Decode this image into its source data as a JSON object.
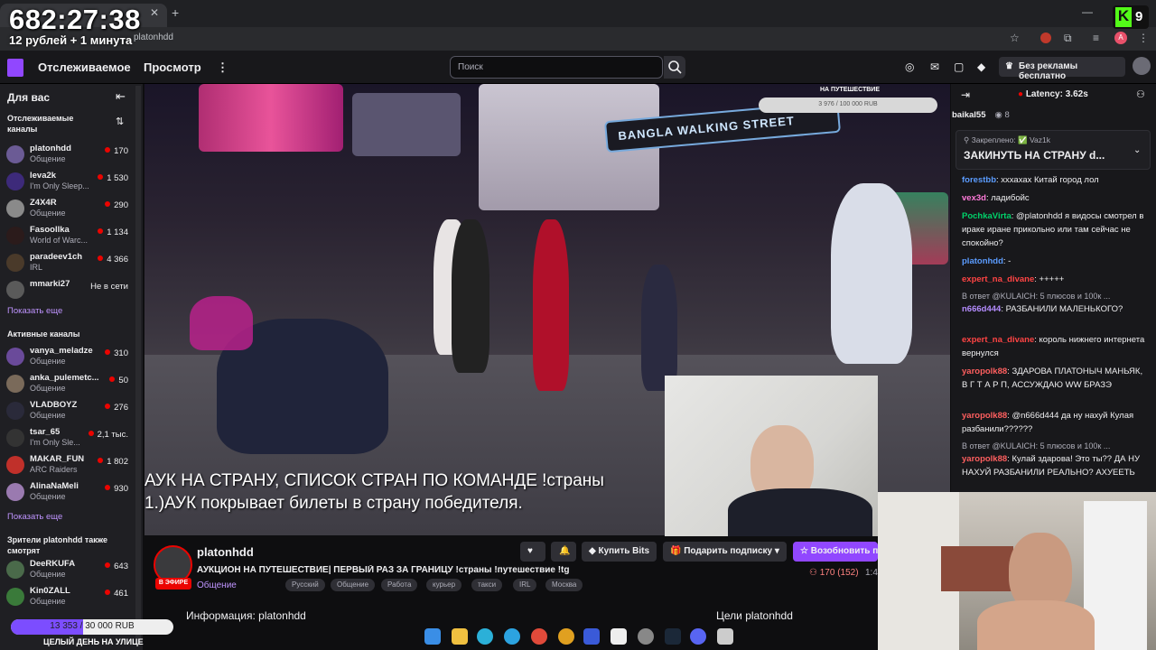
{
  "overlay": {
    "timer": "682:27:38",
    "timer_sub": "12 рублей + 1 минута",
    "k_badge": "K",
    "k_badge_num": "9",
    "goal_title": "НА ПУТЕШЕСТВИЕ",
    "goal_progress": "3 976 / 100 000 RUB",
    "goal_fraction": 0.04,
    "bottom_progress": "13 353 / 30 000 RUB",
    "bottom_fraction": 0.445,
    "bottom_label": "ЦЕЛЫЙ ДЕНЬ НА УЛИЦЕ",
    "subtitle_line1": "АУК НА СТРАНУ, СПИСОК СТРАН ПО КОМАНДЕ !страны",
    "subtitle_line2": "1.)АУК покрывает билеты в страну победителя."
  },
  "browser": {
    "url": "platonhdd",
    "avatar_letter": "A"
  },
  "nav": {
    "following": "Отслеживаемое",
    "browse": "Просмотр",
    "search_placeholder": "Поиск",
    "no_ads": "Без рекламы бесплатно"
  },
  "sidebar": {
    "for_you": "Для вас",
    "followed_title": "Отслеживаемые каналы",
    "followed": [
      {
        "name": "platonhdd",
        "game": "Общение",
        "viewers": "170",
        "color": "#6b5b95"
      },
      {
        "name": "leva2k",
        "game": "I'm Only Sleep...",
        "viewers": "1 530",
        "color": "#3d2a7a"
      },
      {
        "name": "Z4X4R",
        "game": "Общение",
        "viewers": "290",
        "color": "#8a8a8a"
      },
      {
        "name": "Fasoollka",
        "game": "World of Warc...",
        "viewers": "1 134",
        "color": "#2b1b1b"
      },
      {
        "name": "paradeev1ch",
        "game": "IRL",
        "viewers": "4 366",
        "color": "#4a3a2a"
      },
      {
        "name": "mmarki27",
        "game": "",
        "viewers": "Не в сети",
        "color": "#5a5a5a"
      }
    ],
    "show_more": "Показать еще",
    "active_title": "Активные каналы",
    "active": [
      {
        "name": "vanya_meladze",
        "game": "Общение",
        "viewers": "310",
        "color": "#6a4a9a"
      },
      {
        "name": "anka_pulemetc...",
        "game": "Общение",
        "viewers": "50",
        "color": "#7a6a5a"
      },
      {
        "name": "VLADBOYZ",
        "game": "Общение",
        "viewers": "276",
        "color": "#2a2a3a"
      },
      {
        "name": "tsar_65",
        "game": "I'm Only Sle...",
        "viewers": "2,1 тыс.",
        "color": "#333"
      },
      {
        "name": "MAKAR_FUN",
        "game": "ARC Raiders",
        "viewers": "1 802",
        "color": "#c0302a"
      },
      {
        "name": "AlinaNaMeli",
        "game": "Общение",
        "viewers": "930",
        "color": "#9a7ab0"
      }
    ],
    "show_more2": "Показать еще",
    "also_watch_title": "Зрители platonhdd также смотрят",
    "also": [
      {
        "name": "DeeRKUFA",
        "game": "Общение",
        "viewers": "643",
        "color": "#4a6a4a"
      },
      {
        "name": "Kin0ZALL",
        "game": "Общение",
        "viewers": "461",
        "color": "#3a7a3a"
      }
    ]
  },
  "stream": {
    "name": "platonhdd",
    "title": "АУКЦИОН НА ПУТЕШЕСТВИЕ| ПЕРВЫЙ РАЗ ЗА ГРАНИЦУ !страны !путешествие !tg",
    "live": "В ЭФИРЕ",
    "category": "Общение",
    "tags": [
      "Русский",
      "Общение",
      "Работа",
      "курьер",
      "такси",
      "IRL",
      "Москва"
    ],
    "viewers": "170 (152)",
    "uptime": "1:4",
    "buy_bits": "Купить Bits",
    "gift_sub": "Подарить подписку",
    "resub": "Возобновить по",
    "about": "Информация: platonhdd",
    "goals": "Цели platonhdd"
  },
  "chat": {
    "latency": "Latency: 3.62s",
    "top_user": "baikal55",
    "top_count": "8",
    "pinned_by": "Закреплено: ✅ Vaz1k",
    "pinned_text": "ЗАКИНУТЬ НА СТРАНУ d...",
    "messages": [
      {
        "user": "forestbb",
        "color": "#5b9cff",
        "text": ": хххахах Китай город лол"
      },
      {
        "user": "vex3d",
        "color": "#ff7ad9",
        "text": ": ладибойс"
      },
      {
        "user": "PochkaVirta",
        "color": "#00d26a",
        "text": ": @platonhdd я видосы смотрел в ираке иране прикольно или там сейчас не спокойно?"
      },
      {
        "user": "platonhdd",
        "color": "#5b9cff",
        "text": ": -"
      },
      {
        "user": "expert_na_divane",
        "color": "#ff4444",
        "text": ": +++++"
      },
      {
        "reply": "В ответ @KULAICH: 5 плюсов и 100к ..."
      },
      {
        "user": "n666d444",
        "color": "#b48cff",
        "text": ": РАЗБАНИЛИ МАЛЕНЬКОГО?"
      },
      {
        "user": "expert_na_divane",
        "color": "#ff4444",
        "text": ": король нижнего интернета вернулся"
      },
      {
        "user": "yaropolk88",
        "color": "#ff5f5f",
        "text": ": ЗДАРОВА ПЛАТОНЫЧ МАНЬЯК, В Г Т А Р П, АССУЖДАЮ WW БРАЗЭ"
      },
      {
        "user": "yaropolk88",
        "color": "#ff5f5f",
        "text": ": @n666d444 да ну нахуй Кулая разбанили??????"
      },
      {
        "reply": "В ответ @KULAICH: 5 плюсов и 100к ..."
      },
      {
        "user": "yaropolk88",
        "color": "#ff5f5f",
        "text": ": Кулай здарова! Это ты?? ДА НУ НАХУЙ РАЗБАНИЛИ РЕАЛЬНО? АХУЕЕТЬ"
      }
    ]
  },
  "video_signs": {
    "bangla": "BANGLA WALKING STREET"
  },
  "colors": {
    "accent": "#9147ff",
    "live": "#eb0400",
    "link": "#bf94ff"
  }
}
